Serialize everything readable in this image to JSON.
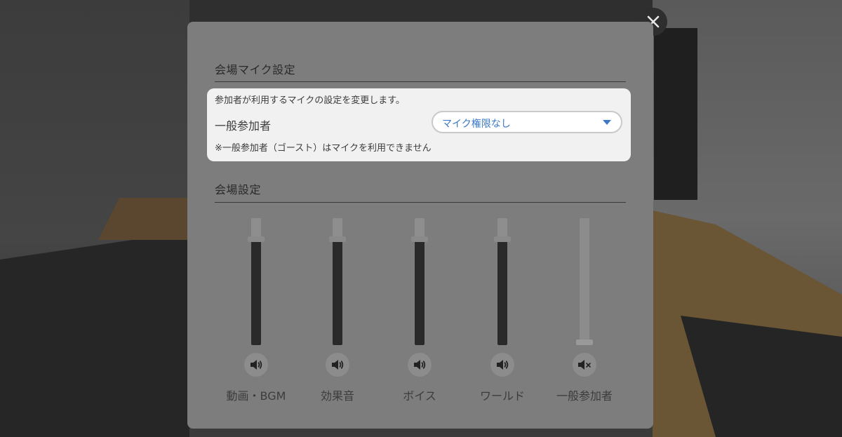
{
  "mic_section": {
    "title": "会場マイク設定",
    "description": "参加者が利用するマイクの設定を変更します。",
    "general_label": "一般参加者",
    "select_value": "マイク権限なし",
    "note": "※一般参加者（ゴースト）はマイクを利用できません"
  },
  "venue_section": {
    "title": "会場設定",
    "channels": [
      {
        "label": "動画・BGM",
        "level": 0.85,
        "muted": false,
        "icon": "speaker-icon"
      },
      {
        "label": "効果音",
        "level": 0.85,
        "muted": false,
        "icon": "speaker-icon"
      },
      {
        "label": "ボイス",
        "level": 0.85,
        "muted": false,
        "icon": "speaker-icon"
      },
      {
        "label": "ワールド",
        "level": 0.85,
        "muted": false,
        "icon": "speaker-icon"
      },
      {
        "label": "一般参加者",
        "level": 0.0,
        "muted": true,
        "icon": "speaker-muted-icon"
      }
    ]
  },
  "colors": {
    "select_text": "#3a78c8",
    "arrow": "#3a78c8",
    "panel": "#7d7d7d",
    "card": "#f1f1f1"
  },
  "icons": {
    "close": "close-icon",
    "dropdown": "chevron-down-icon"
  }
}
